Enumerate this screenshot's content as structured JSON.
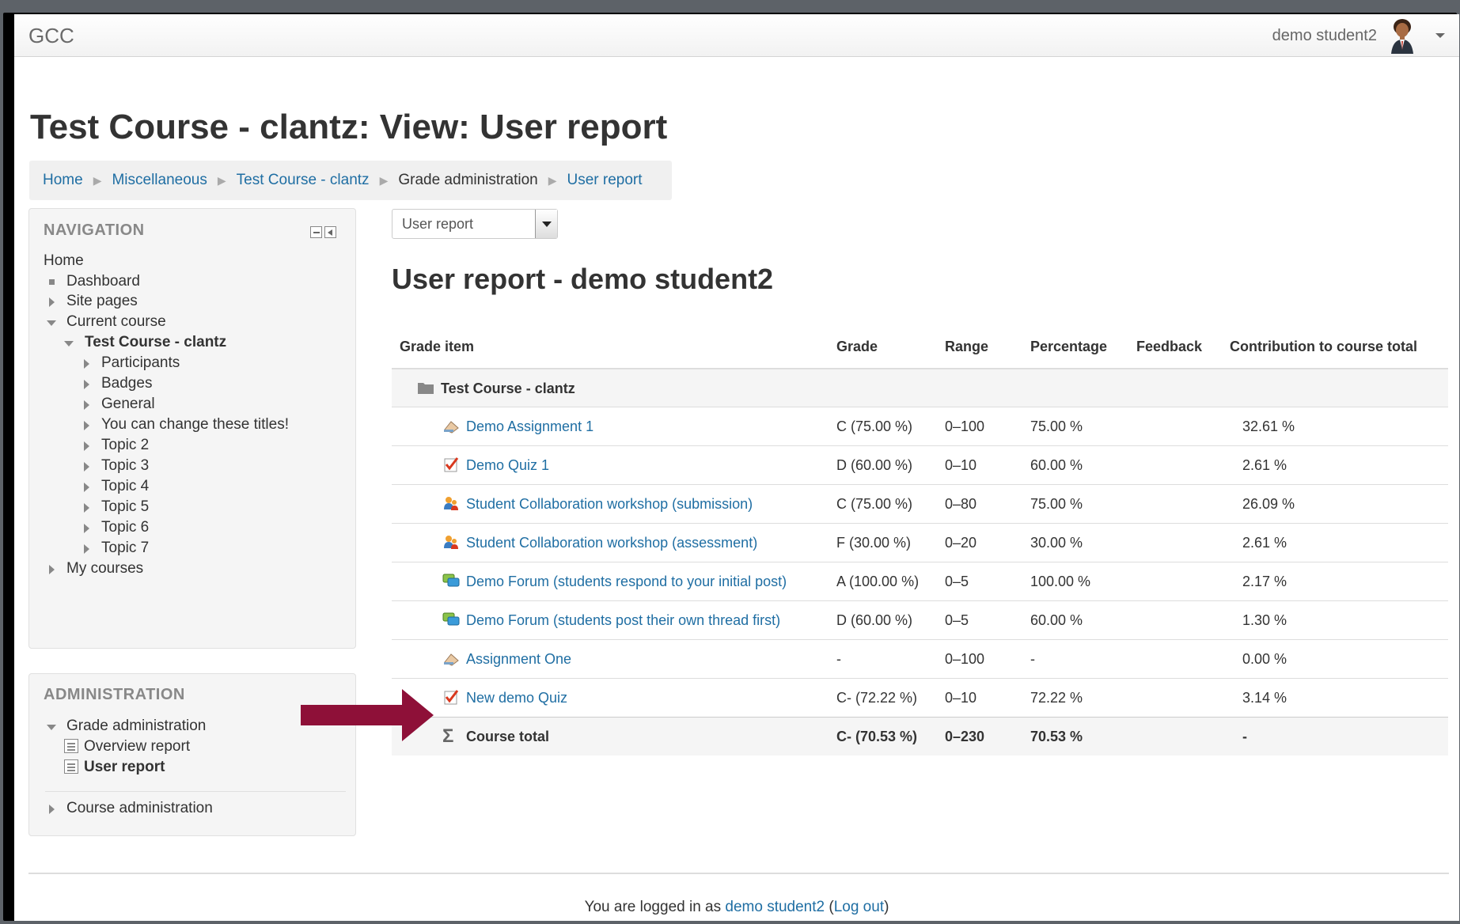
{
  "header": {
    "brand": "GCC",
    "username": "demo student2"
  },
  "page": {
    "title": "Test Course - clantz: View: User report"
  },
  "breadcrumb": [
    {
      "label": "Home",
      "link": true
    },
    {
      "label": "Miscellaneous",
      "link": true
    },
    {
      "label": "Test Course - clantz",
      "link": true
    },
    {
      "label": "Grade administration",
      "link": false
    },
    {
      "label": "User report",
      "link": true
    }
  ],
  "navigation": {
    "title": "NAVIGATION",
    "home": "Home",
    "dashboard": "Dashboard",
    "site_pages": "Site pages",
    "current_course": "Current course",
    "course": "Test Course - clantz",
    "course_items": [
      "Participants",
      "Badges",
      "General",
      "You can change these titles!",
      "Topic 2",
      "Topic 3",
      "Topic 4",
      "Topic 5",
      "Topic 6",
      "Topic 7"
    ],
    "my_courses": "My courses"
  },
  "administration": {
    "title": "ADMINISTRATION",
    "grade_admin": "Grade administration",
    "overview_report": "Overview report",
    "user_report": "User report",
    "course_admin": "Course administration"
  },
  "report": {
    "selector_value": "User report",
    "heading": "User report - demo student2",
    "columns": [
      "Grade item",
      "Grade",
      "Range",
      "Percentage",
      "Feedback",
      "Contribution to course total"
    ],
    "category": "Test Course - clantz",
    "rows": [
      {
        "item": "Demo Assignment 1",
        "icon": "assignment-icon",
        "grade": "C (75.00 %)",
        "range": "0–100",
        "percentage": "75.00 %",
        "feedback": "",
        "contribution": "32.61 %"
      },
      {
        "item": "Demo Quiz 1",
        "icon": "quiz-icon",
        "grade": "D (60.00 %)",
        "range": "0–10",
        "percentage": "60.00 %",
        "feedback": "",
        "contribution": "2.61 %"
      },
      {
        "item": "Student Collaboration workshop (submission)",
        "icon": "workshop-icon",
        "grade": "C (75.00 %)",
        "range": "0–80",
        "percentage": "75.00 %",
        "feedback": "",
        "contribution": "26.09 %"
      },
      {
        "item": "Student Collaboration workshop (assessment)",
        "icon": "workshop-icon",
        "grade": "F (30.00 %)",
        "range": "0–20",
        "percentage": "30.00 %",
        "feedback": "",
        "contribution": "2.61 %"
      },
      {
        "item": "Demo Forum (students respond to your initial post)",
        "icon": "forum-icon",
        "grade": "A (100.00 %)",
        "range": "0–5",
        "percentage": "100.00 %",
        "feedback": "",
        "contribution": "2.17 %"
      },
      {
        "item": "Demo Forum (students post their own thread first)",
        "icon": "forum-icon",
        "grade": "D (60.00 %)",
        "range": "0–5",
        "percentage": "60.00 %",
        "feedback": "",
        "contribution": "1.30 %"
      },
      {
        "item": "Assignment One",
        "icon": "assignment-icon",
        "grade": "-",
        "range": "0–100",
        "percentage": "-",
        "feedback": "",
        "contribution": "0.00 %"
      },
      {
        "item": "New demo Quiz",
        "icon": "quiz-icon",
        "grade": "C- (72.22 %)",
        "range": "0–10",
        "percentage": "72.22 %",
        "feedback": "",
        "contribution": "3.14 %"
      }
    ],
    "total": {
      "item": "Course total",
      "grade": "C- (70.53 %)",
      "range": "0–230",
      "percentage": "70.53 %",
      "contribution": "-"
    }
  },
  "footer": {
    "prefix": "You are logged in as ",
    "user": "demo student2",
    "open_paren": " (",
    "logout": "Log out",
    "close_paren": ")"
  },
  "colors": {
    "link": "#1f6ea3",
    "arrow": "#8e1038",
    "block_bg": "#f5f5f5"
  }
}
